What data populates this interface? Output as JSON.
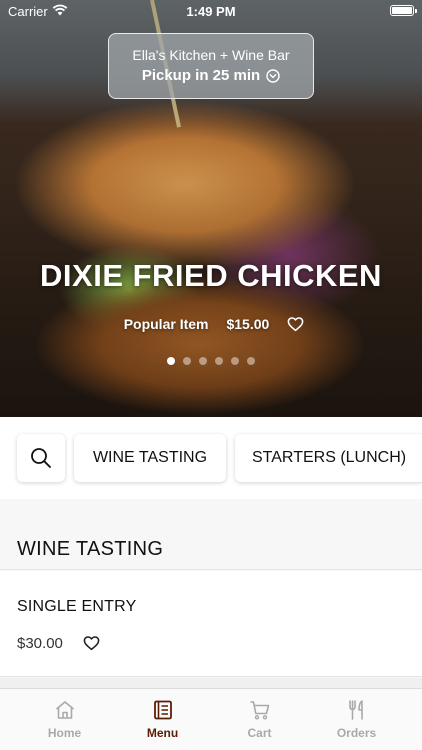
{
  "status_bar": {
    "carrier": "Carrier",
    "time": "1:49 PM"
  },
  "restaurant": {
    "name": "Ella's Kitchen + Wine Bar",
    "pickup": "Pickup in 25 min"
  },
  "featured": {
    "title": "DIXIE FRIED CHICKEN",
    "tag": "Popular Item",
    "price": "$15.00",
    "carousel": {
      "count": 6,
      "active_index": 0
    }
  },
  "categories": {
    "search_icon": "search-icon",
    "chips": [
      "WINE TASTING",
      "STARTERS (LUNCH)"
    ]
  },
  "section": {
    "title": "WINE TASTING",
    "items": [
      {
        "name": "SINGLE ENTRY",
        "price": "$30.00"
      }
    ]
  },
  "tab_bar": {
    "tabs": [
      {
        "label": "Home",
        "icon": "home-icon",
        "active": false
      },
      {
        "label": "Menu",
        "icon": "menu-book-icon",
        "active": true
      },
      {
        "label": "Cart",
        "icon": "cart-icon",
        "active": false
      },
      {
        "label": "Orders",
        "icon": "fork-knife-icon",
        "active": false
      }
    ]
  },
  "colors": {
    "accent": "#5a1e06",
    "inactive_tab": "#a9a9a9"
  }
}
